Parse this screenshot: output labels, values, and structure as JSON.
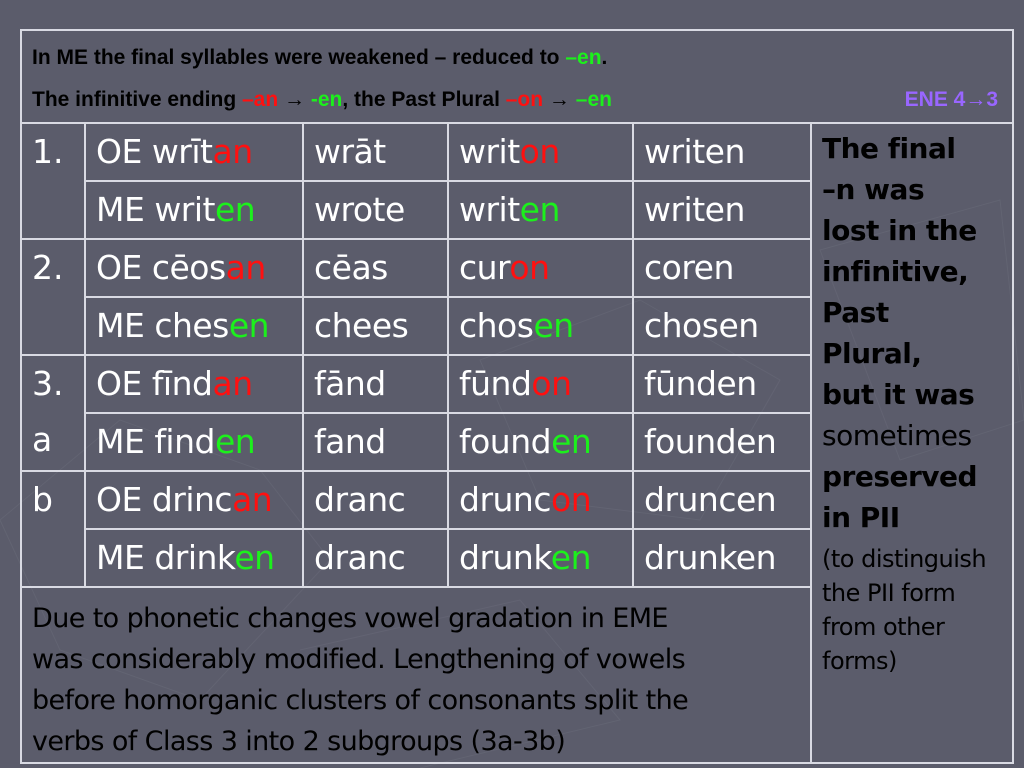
{
  "slide": {
    "header": {
      "line1": {
        "text": "In ME the final syllables were weakened – reduced to ",
        "ending": "–en",
        "tail": "."
      },
      "line2": {
        "part1": "The infinitive ending ",
        "ending1": "–an",
        "arrow1": " → ",
        "ending2": "-en",
        "part2": ", the Past Plural ",
        "ending3": "–on",
        "arrow2": " → ",
        "ending4": "–en",
        "ene_label": "ENE 4→3"
      }
    },
    "colors": {
      "background": "#5b5c6b",
      "old_ending": "#ff1010",
      "new_ending": "#1cf01c",
      "ene_label": "#9966ff",
      "border": "#d9dae3"
    },
    "classes": [
      {
        "labels": [
          "1."
        ],
        "rows": [
          [
            {
              "stem": "OE wrīt",
              "ending": "an",
              "type": "old"
            },
            {
              "stem": "wrāt",
              "ending": ""
            },
            {
              "stem": "writ",
              "ending": "on",
              "type": "old"
            },
            {
              "stem": "writen",
              "ending": ""
            }
          ],
          [
            {
              "stem": "ME writ",
              "ending": "en",
              "type": "new"
            },
            {
              "stem": "wrote",
              "ending": ""
            },
            {
              "stem": "writ",
              "ending": "en",
              "type": "new"
            },
            {
              "stem": "writen",
              "ending": ""
            }
          ]
        ]
      },
      {
        "labels": [
          "2."
        ],
        "rows": [
          [
            {
              "stem": "OE cēos",
              "ending": "an",
              "type": "old"
            },
            {
              "stem": "cēas",
              "ending": ""
            },
            {
              "stem": "cur",
              "ending": "on",
              "type": "old"
            },
            {
              "stem": "coren",
              "ending": ""
            }
          ],
          [
            {
              "stem": "ME ches",
              "ending": "en",
              "type": "new"
            },
            {
              "stem": "chees",
              "ending": ""
            },
            {
              "stem": "chos",
              "ending": "en",
              "type": "new"
            },
            {
              "stem": "chosen",
              "ending": ""
            }
          ]
        ]
      },
      {
        "labels": [
          "3.",
          "a"
        ],
        "rows": [
          [
            {
              "stem": "OE fīnd",
              "ending": "an",
              "type": "old"
            },
            {
              "stem": "fānd",
              "ending": ""
            },
            {
              "stem": "fūnd",
              "ending": "on",
              "type": "old"
            },
            {
              "stem": "fūnden",
              "ending": ""
            }
          ],
          [
            {
              "stem": "ME find",
              "ending": "en",
              "type": "new"
            },
            {
              "stem": "fand",
              "ending": ""
            },
            {
              "stem": "found",
              "ending": "en",
              "type": "new"
            },
            {
              "stem": "founden",
              "ending": ""
            }
          ]
        ]
      },
      {
        "labels": [
          "b"
        ],
        "rows": [
          [
            {
              "stem": "OE drinc",
              "ending": "an",
              "type": "old"
            },
            {
              "stem": "dranc",
              "ending": ""
            },
            {
              "stem": "drunc",
              "ending": "on",
              "type": "old"
            },
            {
              "stem": "druncen",
              "ending": ""
            }
          ],
          [
            {
              "stem": "ME drink",
              "ending": "en",
              "type": "new"
            },
            {
              "stem": "dranc",
              "ending": ""
            },
            {
              "stem": "drunk",
              "ending": "en",
              "type": "new"
            },
            {
              "stem": "drunken",
              "ending": ""
            }
          ]
        ]
      }
    ],
    "side_note": {
      "bold_lines": [
        "The final",
        "–n was",
        "lost in the",
        "infinitive,",
        "Past",
        "Plural,",
        "but it was"
      ],
      "normal_line": "sometimes",
      "bold_lines2": [
        "preserved",
        "in PII"
      ],
      "small_lines": [
        "(to distinguish",
        "the PII form",
        "from other",
        "forms)"
      ]
    },
    "footer": {
      "lines": [
        "Due to phonetic changes vowel gradation in EME",
        "was considerably modified. Lengthening of vowels",
        "before homorganic clusters of consonants split the",
        "verbs of Class 3 into 2 subgroups (3a-3b)"
      ]
    }
  }
}
